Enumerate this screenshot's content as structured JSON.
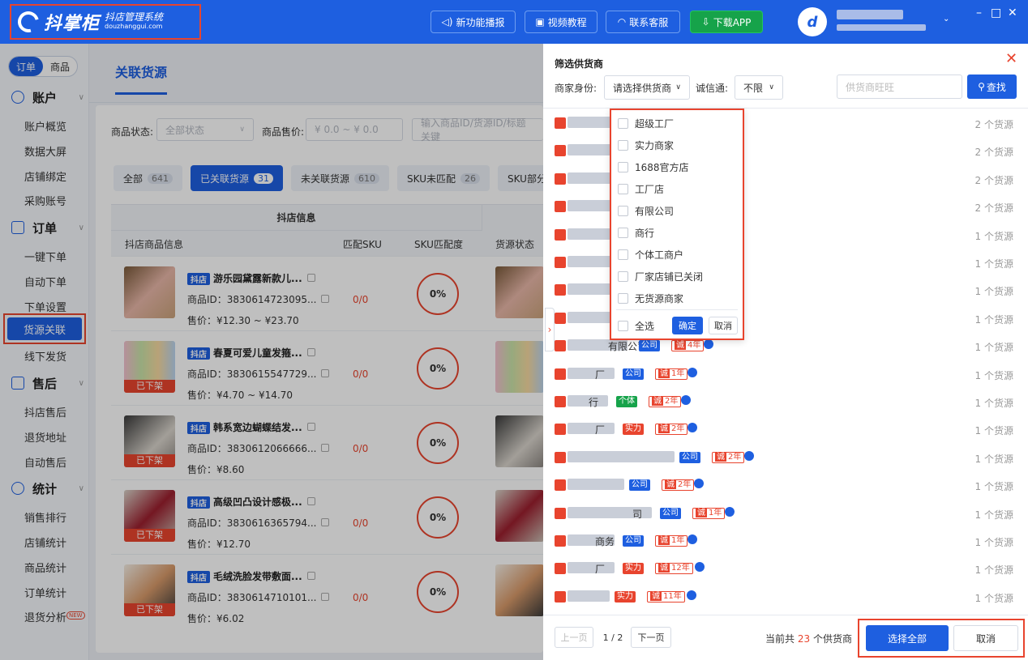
{
  "header": {
    "logo_text": "抖掌柜",
    "logo_sub": "抖店管理系统",
    "logo_domain": "douzhanggui.com",
    "btn_news": "新功能播报",
    "btn_video": "视频教程",
    "btn_service": "联系客服",
    "btn_download": "下载APP"
  },
  "sidebar": {
    "toggle": [
      "订单",
      "商品"
    ],
    "sections": [
      {
        "title": "账户",
        "items": [
          "账户概览",
          "数据大屏",
          "店铺绑定",
          "采购账号"
        ]
      },
      {
        "title": "订单",
        "items": [
          "一键下单",
          "自动下单",
          "下单设置",
          "货源关联",
          "线下发货"
        ]
      },
      {
        "title": "售后",
        "items": [
          "抖店售后",
          "退货地址",
          "自动售后"
        ]
      },
      {
        "title": "统计",
        "items": [
          "销售排行",
          "店铺统计",
          "商品统计",
          "订单统计",
          "退货分析"
        ]
      }
    ],
    "new_badge": "NEW"
  },
  "main": {
    "title": "关联货源",
    "filter_status_label": "商品状态:",
    "filter_status_value": "全部状态",
    "filter_price_label": "商品售价:",
    "filter_price_placeholder": "¥   0.0  ~ ¥   0.0",
    "search_placeholder": "输入商品ID/货源ID/标题关键",
    "tabs": [
      {
        "label": "全部",
        "count": "641"
      },
      {
        "label": "已关联货源",
        "count": "31"
      },
      {
        "label": "未关联货源",
        "count": "610"
      },
      {
        "label": "SKU未匹配",
        "count": "26"
      },
      {
        "label": "SKU部分匹配",
        "count": "5"
      }
    ],
    "group_header": "抖店信息",
    "columns": [
      "抖店商品信息",
      "匹配SKU",
      "SKU匹配度",
      "货源状态"
    ],
    "rows": [
      {
        "tag": "抖店",
        "name": "游乐园黛露新款儿...",
        "id": "商品ID：3830614723095...",
        "price": "售价：¥12.30 ~ ¥23.70",
        "match": "0/0",
        "pct": "0%",
        "delisted": ""
      },
      {
        "tag": "抖店",
        "name": "春夏可爱儿童发箍...",
        "id": "商品ID：3830615547729...",
        "price": "售价：¥4.70 ~ ¥14.70",
        "match": "0/0",
        "pct": "0%",
        "delisted": "已下架"
      },
      {
        "tag": "抖店",
        "name": "韩系宽边蝴蝶结发...",
        "id": "商品ID：3830612066666...",
        "price": "售价：¥8.60",
        "match": "0/0",
        "pct": "0%",
        "delisted": "已下架"
      },
      {
        "tag": "抖店",
        "name": "高级凹凸设计感极...",
        "id": "商品ID：3830616365794...",
        "price": "售价：¥12.70",
        "match": "0/0",
        "pct": "0%",
        "delisted": "已下架"
      },
      {
        "tag": "抖店",
        "name": "毛绒洗脸发带敷面...",
        "id": "商品ID：3830614710101...",
        "price": "售价：¥6.02",
        "match": "0/0",
        "pct": "0%",
        "delisted": "已下架"
      }
    ]
  },
  "drawer": {
    "title": "筛选供货商",
    "merchant_label": "商家身份:",
    "merchant_placeholder": "请选择供货商",
    "cx_label": "诚信通:",
    "cx_value": "不限",
    "wangwang_placeholder": "供货商旺旺",
    "search_btn": "查找",
    "dropdown": {
      "options": [
        "超级工厂",
        "实力商家",
        "1688官方店",
        "工厂店",
        "有限公司",
        "商行",
        "个体工商户",
        "厂家店铺已关闭",
        "无货源商家"
      ],
      "select_all": "全选",
      "ok": "确定",
      "cancel": "取消"
    },
    "suppliers": [
      {
        "suffix": "",
        "badges": [],
        "count": "2 个货源"
      },
      {
        "suffix": "",
        "badges": [],
        "count": "2 个货源"
      },
      {
        "suffix": "",
        "badges": [],
        "count": "2 个货源"
      },
      {
        "suffix": "",
        "badges": [],
        "count": "2 个货源"
      },
      {
        "suffix": "",
        "badges": [],
        "count": "1 个货源"
      },
      {
        "suffix": "",
        "badges": [],
        "count": "1 个货源"
      },
      {
        "suffix": "",
        "badges": [],
        "count": "1 个货源"
      },
      {
        "suffix": "",
        "badges": [],
        "count": "1 个货源"
      },
      {
        "suffix": "有限公司",
        "badges": [
          {
            "t": "co",
            "label": "公司"
          },
          {
            "t": "yr",
            "label": "4年"
          }
        ],
        "count": "1 个货源"
      },
      {
        "suffix": "厂",
        "badges": [
          {
            "t": "co",
            "label": "公司"
          },
          {
            "t": "yr",
            "label": "1年"
          }
        ],
        "count": "1 个货源"
      },
      {
        "suffix": "行",
        "badges": [
          {
            "t": "ind",
            "label": "个体"
          },
          {
            "t": "yr",
            "label": "2年"
          }
        ],
        "count": "1 个货源"
      },
      {
        "suffix": "厂",
        "badges": [
          {
            "t": "sl",
            "label": "实力"
          },
          {
            "t": "yr",
            "label": "2年"
          }
        ],
        "count": "1 个货源"
      },
      {
        "suffix": "",
        "badges": [
          {
            "t": "co",
            "label": "公司"
          },
          {
            "t": "yr",
            "label": "2年"
          }
        ],
        "count": "1 个货源"
      },
      {
        "suffix": "",
        "badges": [
          {
            "t": "co",
            "label": "公司"
          },
          {
            "t": "yr",
            "label": "2年"
          }
        ],
        "count": "1 个货源"
      },
      {
        "suffix": "司",
        "badges": [
          {
            "t": "co",
            "label": "公司"
          },
          {
            "t": "yr",
            "label": "1年"
          }
        ],
        "count": "1 个货源"
      },
      {
        "suffix": "商务",
        "badges": [
          {
            "t": "co",
            "label": "公司"
          },
          {
            "t": "yr",
            "label": "1年"
          }
        ],
        "count": "1 个货源"
      },
      {
        "suffix": "厂",
        "badges": [
          {
            "t": "sl",
            "label": "实力"
          },
          {
            "t": "yr",
            "label": "12年"
          }
        ],
        "count": "1 个货源"
      },
      {
        "suffix": "",
        "badges": [
          {
            "t": "sl",
            "label": "实力"
          },
          {
            "t": "yr",
            "label": "11年"
          }
        ],
        "count": "1 个货源"
      }
    ],
    "year_prefix": "诚",
    "pager": {
      "prev": "上一页",
      "page": "1 / 2",
      "next": "下一页"
    },
    "total_pre": "当前共",
    "total_num": "23",
    "total_post": "个供货商",
    "select_all_btn": "选择全部",
    "cancel_btn": "取消"
  }
}
